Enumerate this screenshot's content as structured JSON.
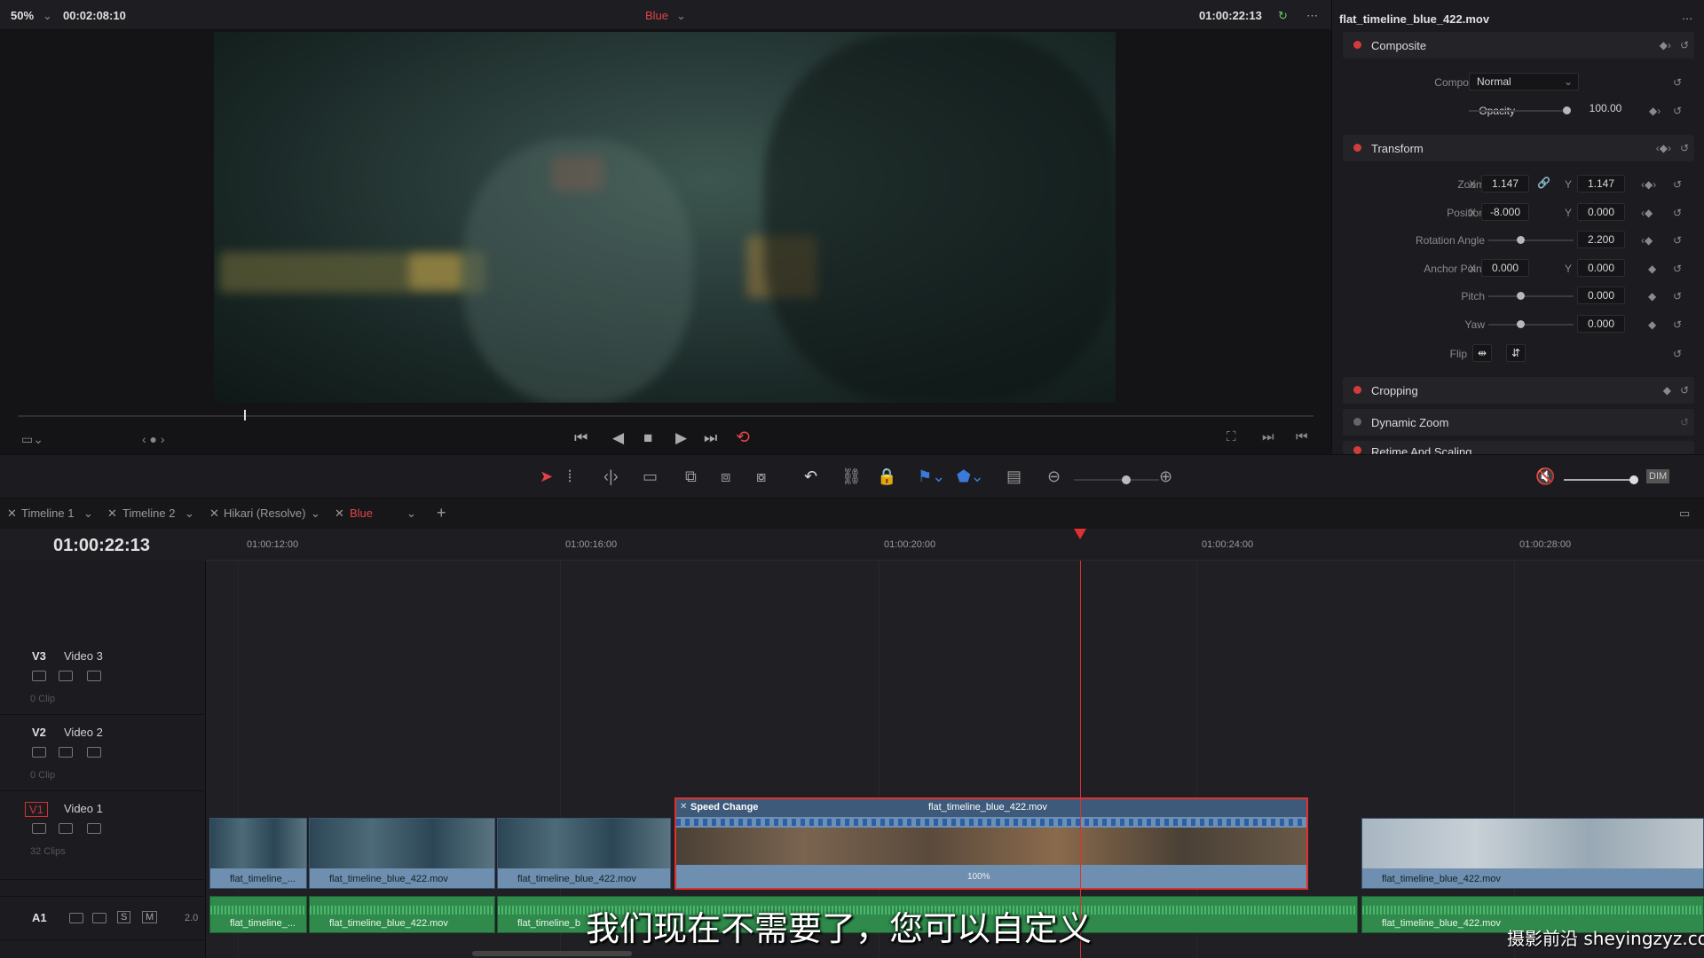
{
  "viewer": {
    "zoom": "50%",
    "duration": "00:02:08:10",
    "clip_name": "Blue",
    "timecode": "01:00:22:13"
  },
  "inspector": {
    "title": "flat_timeline_blue_422.mov",
    "composite": {
      "label": "Composite",
      "mode_label": "Composite Mode",
      "mode_value": "Normal",
      "opacity_label": "Opacity",
      "opacity_value": "100.00"
    },
    "transform": {
      "label": "Transform",
      "zoom_label": "Zoom",
      "zoom_x": "1.147",
      "zoom_y": "1.147",
      "position_label": "Position",
      "position_x": "-8.000",
      "position_y": "0.000",
      "rotation_label": "Rotation Angle",
      "rotation_value": "2.200",
      "anchor_label": "Anchor Point",
      "anchor_x": "0.000",
      "anchor_y": "0.000",
      "pitch_label": "Pitch",
      "pitch_value": "0.000",
      "yaw_label": "Yaw",
      "yaw_value": "0.000",
      "flip_label": "Flip",
      "x": "X",
      "y": "Y"
    },
    "cropping": "Cropping",
    "dynamic_zoom": "Dynamic Zoom",
    "retime": "Retime And Scaling"
  },
  "toolbar": {
    "dim": "DIM"
  },
  "tabs": [
    {
      "label": "Timeline 1"
    },
    {
      "label": "Timeline 2"
    },
    {
      "label": "Hikari (Resolve)"
    },
    {
      "label": "Blue",
      "active": true
    }
  ],
  "timeline": {
    "timecode": "01:00:22:13",
    "ruler": [
      "01:00:12:00",
      "01:00:16:00",
      "01:00:20:00",
      "01:00:24:00",
      "01:00:28:00"
    ],
    "tracks": [
      {
        "code": "V3",
        "name": "Video 3",
        "count": "0 Clip"
      },
      {
        "code": "V2",
        "name": "Video 2",
        "count": "0 Clip"
      },
      {
        "code": "V1",
        "name": "Video 1",
        "count": "32 Clips"
      },
      {
        "code": "A1",
        "name": "",
        "count": "2.0"
      }
    ],
    "video_clips": [
      "flat_timeline_...",
      "flat_timeline_blue_422.mov",
      "flat_timeline_blue_422.mov",
      "flat_timeline_blue_422.mov"
    ],
    "speed_clip": {
      "title": "Speed Change",
      "name": "flat_timeline_blue_422.mov",
      "speed": "100%"
    },
    "audio_clips": [
      "flat_timeline_...",
      "flat_timeline_blue_422.mov",
      "flat_timeline_b",
      "flat_timeline_blue_422.mov"
    ],
    "a1_buttons": {
      "s": "S",
      "m": "M"
    }
  },
  "overlay": {
    "subtitle": "我们现在不需要了，您可以自定义",
    "watermark": "摄影前沿 sheyingzyz.com"
  },
  "colors": {
    "accent_red": "#d23c3c",
    "video_clip": "#6f8fb0",
    "audio_clip": "#2f8a4b",
    "playhead": "#e03030"
  }
}
